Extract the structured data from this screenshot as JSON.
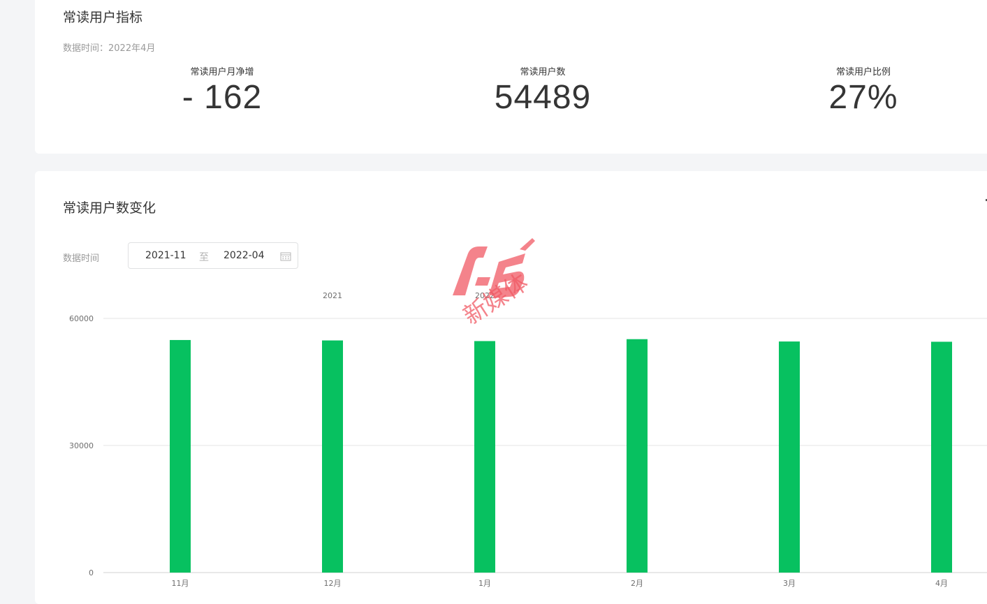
{
  "metrics_card": {
    "title": "常读用户指标",
    "data_time": "数据时间：2022年4月",
    "metrics": [
      {
        "label": "常读用户月净增",
        "value": "- 162"
      },
      {
        "label": "常读用户数",
        "value": "54489"
      },
      {
        "label": "常读用户比例",
        "value": "27%"
      }
    ]
  },
  "chart_card": {
    "title": "常读用户数变化",
    "range_label": "数据时间",
    "range_start": "2021-11",
    "range_separator": "至",
    "range_end": "2022-04",
    "calendar_icon": "calendar-icon"
  },
  "watermark": {
    "text": "新媒体",
    "logo": "A5"
  },
  "colors": {
    "bar": "#07c160",
    "gridline": "#e6e6e6",
    "watermark": "#f05a64"
  },
  "chart_data": {
    "type": "bar",
    "categories": [
      "11月",
      "12月",
      "1月",
      "2月",
      "3月",
      "4月"
    ],
    "year_labels": [
      {
        "label": "2021",
        "at_category": 1
      },
      {
        "label": "2022",
        "at_category": 2
      }
    ],
    "series": [
      {
        "values": [
          54900,
          54800,
          54650,
          55100,
          54550,
          54489
        ]
      }
    ],
    "ylim": [
      0,
      60000
    ],
    "yticks": [
      0,
      30000,
      60000
    ],
    "grid": true,
    "title": "",
    "xlabel": "",
    "ylabel": ""
  }
}
